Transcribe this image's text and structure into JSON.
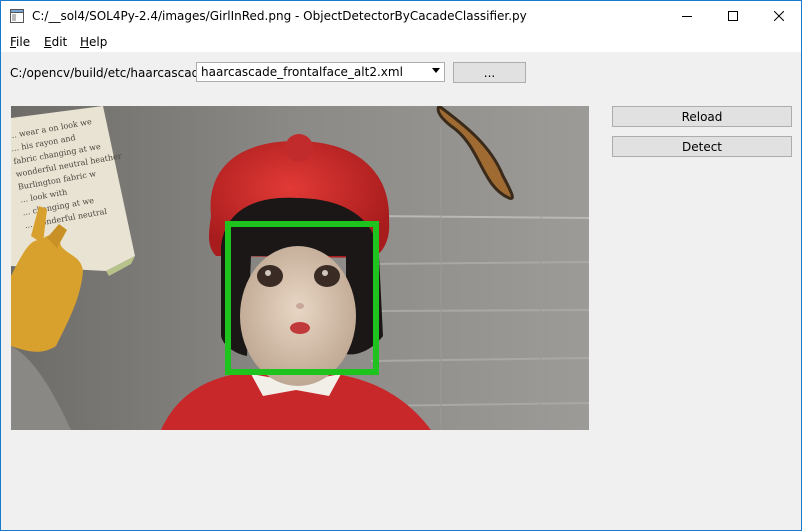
{
  "window": {
    "title": "C:/__sol4/SOL4Py-2.4/images/GirlInRed.png - ObjectDetectorByCacadeClassifier.py",
    "icon": "app-window-icon",
    "controls": [
      "minimize-icon",
      "maximize-icon",
      "close-icon"
    ]
  },
  "menu": {
    "items": [
      {
        "mnemonic": "F",
        "rest": "ile"
      },
      {
        "mnemonic": "E",
        "rest": "dit"
      },
      {
        "mnemonic": "H",
        "rest": "elp"
      }
    ]
  },
  "toolbar": {
    "path_label": "C:/opencv/build/etc/haarcascades",
    "classifier_selected": "haarcascade_frontalface_alt2.xml",
    "browse_label": "..."
  },
  "actions": {
    "reload_label": "Reload",
    "detect_label": "Detect"
  },
  "image": {
    "description_icon": "photo-of-doll-in-red",
    "page_text": [
      "... wear a on look we",
      "... his rayon and",
      "fabric changing at we",
      "wonderful neutral heather",
      "Burlington fabric w",
      "... look with",
      "... changing at we",
      "... wonderful neutral"
    ],
    "detection_color": "#1ec31e"
  },
  "colors": {
    "window_border": "#1979ca",
    "window_bg": "#f0f0f0",
    "button_bg": "#e1e1e1",
    "button_border": "#adadad"
  }
}
